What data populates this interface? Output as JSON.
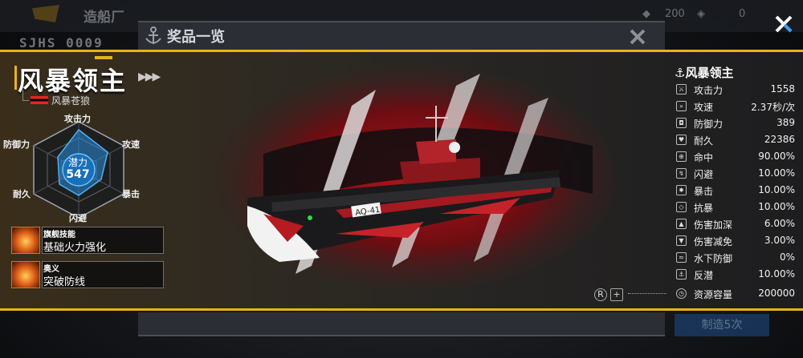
{
  "background": {
    "title": "造船厂",
    "code": "SJHS 0009",
    "resource_value": "200",
    "resource_value2": "0",
    "build_button": "制造5次"
  },
  "modal": {
    "title": "奖品一览"
  },
  "ship": {
    "name": "风暴领主",
    "sub_name": "风暴苍狼",
    "hull_number": "AQ-41",
    "potential_label": "潜力",
    "potential_value": "547",
    "radar": {
      "attack": "攻击力",
      "speed": "攻速",
      "crit": "暴击",
      "evade": "闪避",
      "durability": "耐久",
      "defense": "防御力"
    },
    "skills": [
      {
        "category": "旗舰技能",
        "name": "基础火力强化"
      },
      {
        "category": "奥义",
        "name": "突破防线"
      }
    ]
  },
  "stats": {
    "title": "风暴领主",
    "rows": [
      {
        "icon": "sword-icon",
        "label": "攻击力",
        "value": "1558"
      },
      {
        "icon": "speed-icon",
        "label": "攻速",
        "value": "2.37秒/次"
      },
      {
        "icon": "shield-icon",
        "label": "防御力",
        "value": "389"
      },
      {
        "icon": "heart-icon",
        "label": "耐久",
        "value": "22386"
      },
      {
        "icon": "crosshair-icon",
        "label": "命中",
        "value": "90.00%"
      },
      {
        "icon": "evade-icon",
        "label": "闪避",
        "value": "10.00%"
      },
      {
        "icon": "crit-icon",
        "label": "暴击",
        "value": "10.00%"
      },
      {
        "icon": "resist-icon",
        "label": "抗暴",
        "value": "10.00%"
      },
      {
        "icon": "damage-up-icon",
        "label": "伤害加深",
        "value": "6.00%"
      },
      {
        "icon": "damage-down-icon",
        "label": "伤害减免",
        "value": "3.00%"
      },
      {
        "icon": "depth-defense-icon",
        "label": "水下防御",
        "value": "0%"
      },
      {
        "icon": "anti-sub-icon",
        "label": "反潜",
        "value": "10.00%"
      },
      {
        "icon": "clock-icon",
        "label": "资源容量",
        "value": "200000"
      }
    ]
  },
  "colors": {
    "accent_gold": "#e8b21e",
    "ship_red": "#c4232a",
    "panel_bg": "#2f2a22"
  }
}
